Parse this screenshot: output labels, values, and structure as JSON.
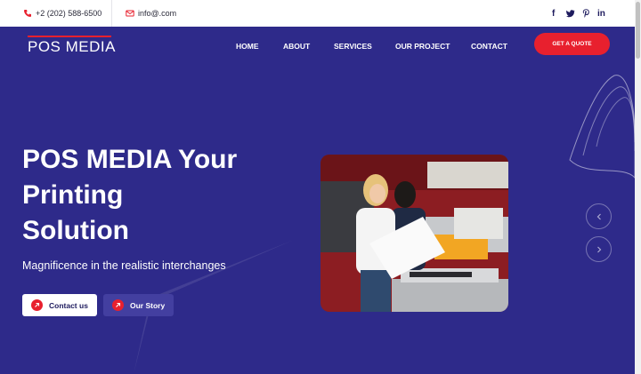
{
  "topbar": {
    "phone": "+2 (202) 588-6500",
    "email": "info@.com",
    "social": [
      "f",
      "twitter",
      "pinterest",
      "in"
    ]
  },
  "header": {
    "logo": "POS MEDIA",
    "nav": [
      "HOME",
      "ABOUT",
      "SERVICES",
      "OUR PROJECT",
      "CONTACT"
    ],
    "cta": "GET A QUOTE"
  },
  "hero": {
    "title_line1": "POS MEDIA Your",
    "title_line2": "Printing",
    "title_line3": "Solution",
    "subtitle": "Magnificence in the realistic interchanges",
    "primary_button": "Contact us",
    "secondary_button": "Our Story"
  },
  "colors": {
    "background": "#2e2a8a",
    "accent": "#e8202e",
    "white": "#ffffff"
  },
  "icons": [
    "phone-icon",
    "mail-icon",
    "facebook-icon",
    "twitter-icon",
    "pinterest-icon",
    "linkedin-icon",
    "arrow-up-right-icon",
    "chevron-left-icon",
    "chevron-right-icon"
  ]
}
